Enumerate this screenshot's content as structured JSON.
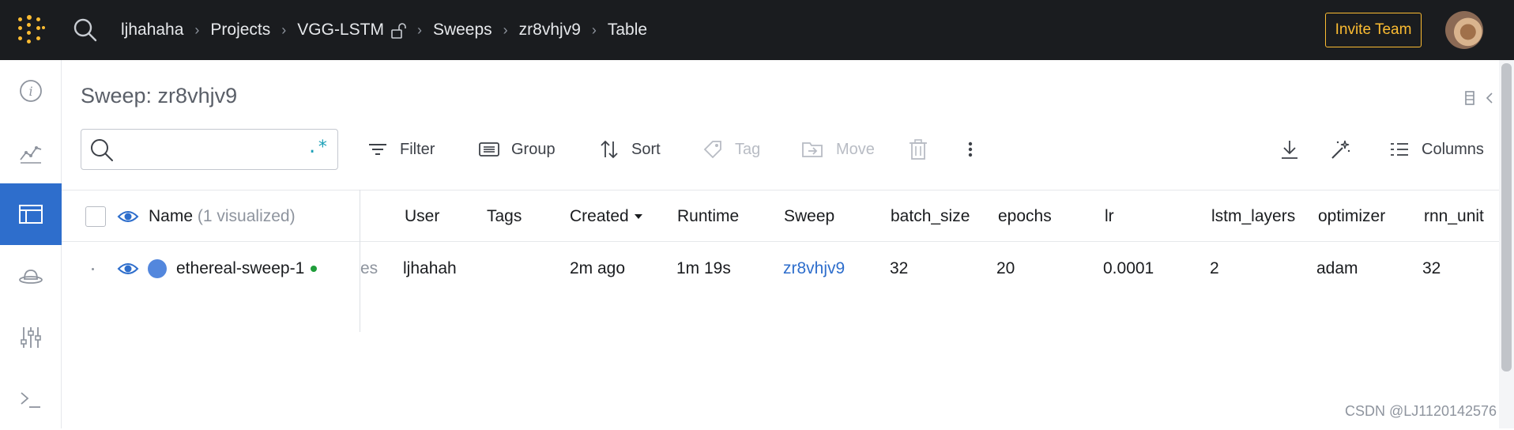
{
  "header": {
    "breadcrumbs": [
      "ljhahaha",
      "Projects",
      "VGG-LSTM",
      "Sweeps",
      "zr8vhjv9",
      "Table"
    ],
    "invite_label": "Invite Team"
  },
  "page": {
    "title": "Sweep: zr8vhjv9"
  },
  "toolbar": {
    "search_placeholder": "",
    "regex_label": ".*",
    "filter": "Filter",
    "group": "Group",
    "sort": "Sort",
    "tag": "Tag",
    "move": "Move",
    "columns": "Columns"
  },
  "table": {
    "name_header": "Name",
    "name_header_note": "(1 visualized)",
    "headers": [
      "User",
      "Tags",
      "Created",
      "Runtime",
      "Sweep",
      "batch_size",
      "epochs",
      "lr",
      "lstm_layers",
      "optimizer",
      "rnn_unit"
    ],
    "rows": [
      {
        "name": "ethereal-sweep-1",
        "hidden_fragment": "es",
        "cells": [
          "ljhahah",
          "",
          "2m ago",
          "1m 19s",
          "zr8vhjv9",
          "32",
          "20",
          "0.0001",
          "2",
          "adam",
          "32"
        ]
      }
    ]
  },
  "watermark": "CSDN @LJ1120142576",
  "colors": {
    "accent": "#fcbc32",
    "active": "#2e6ecc",
    "run_color": "#5387dd",
    "running": "#1f9d3a"
  }
}
